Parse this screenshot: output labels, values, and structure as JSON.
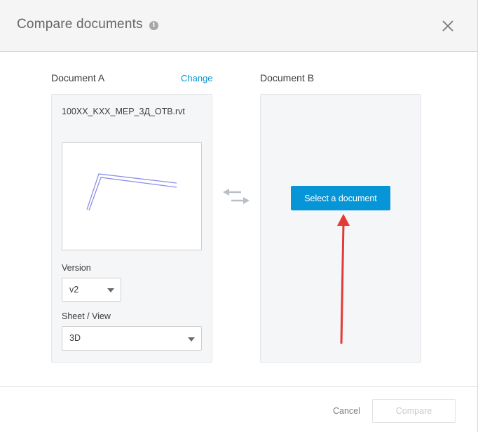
{
  "dialog": {
    "title": "Compare documents",
    "info_icon": "info-icon",
    "close_icon": "close-icon"
  },
  "document_a": {
    "label": "Document A",
    "change_label": "Change",
    "filename": "100XX_KXX_MEP_3Д_OTB.rvt",
    "version_label": "Version",
    "version_value": "v2",
    "sheet_label": "Sheet / View",
    "sheet_value": "3D"
  },
  "document_b": {
    "label": "Document B",
    "select_button_label": "Select a document"
  },
  "footer": {
    "cancel_label": "Cancel",
    "compare_label": "Compare"
  },
  "colors": {
    "accent": "#0696d7",
    "annotation_arrow": "#e53935",
    "panel_bg": "#f5f6f8"
  }
}
